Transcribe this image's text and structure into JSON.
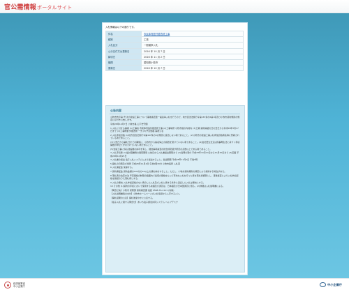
{
  "header": {
    "title_main": "官公需情報",
    "title_sub": "ポータルサイト"
  },
  "intro": "入札情報は以下の通りです。",
  "summary": [
    {
      "label": "件名",
      "value": "市民体育館外壁改修工事",
      "link": true
    },
    {
      "label": "種別",
      "value": "工事"
    },
    {
      "label": "入札区分",
      "value": "一般競争入札"
    },
    {
      "label": "公示日付又は更新日",
      "value": "2016 年 10 月 7 日"
    },
    {
      "label": "締切日",
      "value": "2016 年 11 月 2 日"
    },
    {
      "label": "機関",
      "value": "愛知県小牧市"
    },
    {
      "label": "更新日",
      "value": "2016 年 10 月 7 日"
    }
  ],
  "notice": {
    "title": "公告内容",
    "paragraphs": [
      "小牧市告示第 号 次の建設工事について事後審査型一般競争入札を行うので、地方自治法施行令第167条の6第1項及び小牧市契約規則の規定に基づき公告します。",
      "平成28年10月7日 小牧市長 山下史守朗",
      "1 入札に付する事項 (1)工事名 市民体育館外壁改修工事 (2)工事場所 小牧市堀の内地内 (3)工期 契約締結の日の翌日から平成29年3月17日まで (4)工事概要 外壁改修 一式 (5)予定価格 事後公表",
      "2 入札参加資格 (1)地方自治法施行令第167条の4の規定に該当しない者であること。(2)小牧市の建設工事入札参加資格者名簿に登録されている者であること。",
      "(3)公告日から開札日までの期間に、小牧市から指名停止の措置を受けていない者であること。(4)会社更生法又は民事再生法に基づく手続開始の申立てがなされていない者であること。",
      "(5)当該工事に係る建設業の許可を有し、経営事項審査の総合評定値が所定の点数以上である者であること。",
      "3 入札手続等 (1)設計図書等の閲覧期間 公告日から入札書提出期限まで (2)質問の受付 平成28年10月14日から10月20日まで (3)回答 平成28年10月25日",
      "4 入札書の提出 電子入札システムにより提出すること。提出期限 平成28年11月2日 午後5時",
      "5 開札の日時及び場所 平成28年11月4日 午前9時30分 小牧市役所 入札室",
      "6 入札保証金 免除する。",
      "7 契約保証金 契約金額の100分の10以上の額を納付すること。ただし、小牧市契約規則の規定により免除する場合がある。",
      "8 落札者の決定方法 予定価格の制限の範囲内で最低の価格をもって有効な入札を行った者を落札候補者とし、事後審査により入札参加資格を確認のうえ落札者とする。",
      "9 入札の無効 入札参加資格のない者のした入札及び入札に関する条件に違反した入札は無効とする。",
      "10 その他 (1)契約の手続において使用する言語及び通貨は、日本語及び日本国通貨に限る。(2)詳細は入札説明書による。",
      "【問合せ先】小牧市 総務部 契約検査課 電話 0568-76-1111 (内線)",
      "【入札説明書等の交付】小牧市ホームページの入札情報から入手すること。",
      "【開札結果の公表】開札後速やかに公表する。",
      "【電子入札に関する問合せ】あいち電子調達共同システム ヘルプデスク"
    ]
  },
  "footer": {
    "gov_line1": "経済産業省",
    "gov_line2": "中小企業庁",
    "sme_label": "中小企業庁"
  }
}
